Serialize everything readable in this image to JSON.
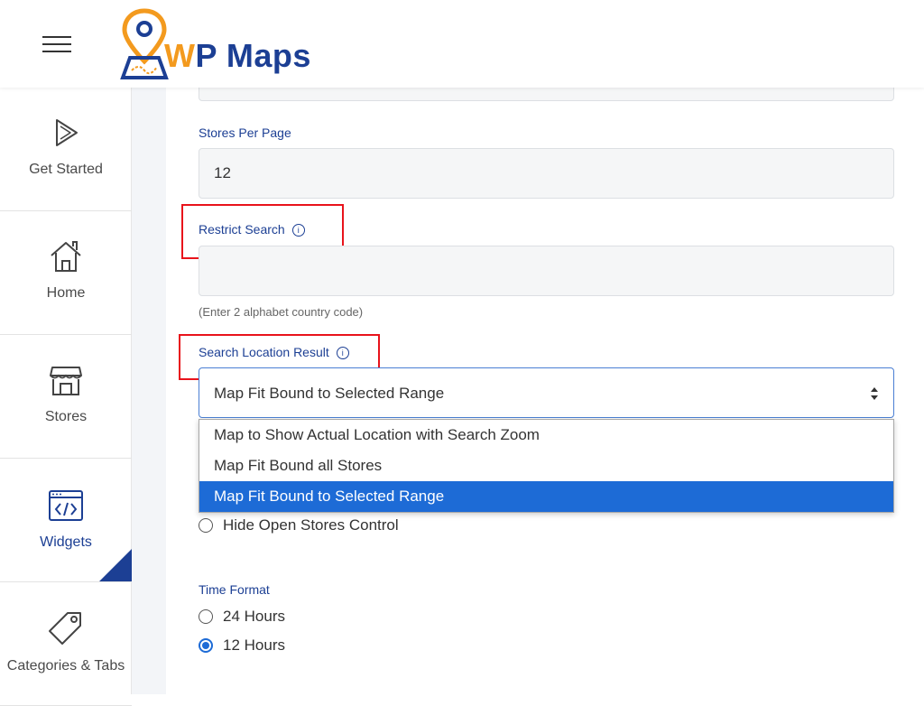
{
  "brand": {
    "logo_text_accent": "W",
    "logo_text_rest": "P Maps",
    "colors": {
      "primary": "#1c3f94",
      "accent": "#f39a1e",
      "highlight": "#e8131b",
      "selected": "#1d6bd6"
    }
  },
  "sidebar": {
    "items": [
      {
        "label": "Get Started",
        "icon": "play-icon"
      },
      {
        "label": "Home",
        "icon": "home-icon"
      },
      {
        "label": "Stores",
        "icon": "store-icon"
      },
      {
        "label": "Widgets",
        "icon": "code-window-icon"
      },
      {
        "label": "Categories & Tabs",
        "icon": "tag-icon"
      }
    ],
    "active": "Widgets"
  },
  "form": {
    "stores_per_page": {
      "label": "Stores Per Page",
      "value": "12"
    },
    "restrict_search": {
      "label": "Restrict Search",
      "value": "",
      "hint": "(Enter 2 alphabet country code)"
    },
    "search_location_result": {
      "label": "Search Location Result",
      "selected": "Map Fit Bound to Selected Range",
      "options": [
        "Map to Show Actual Location with Search Zoom",
        "Map Fit Bound all Stores",
        "Map Fit Bound to Selected Range"
      ]
    },
    "hide_open_stores": {
      "label": "Hide Open Stores Control"
    },
    "time_format": {
      "label": "Time Format",
      "options": [
        "24 Hours",
        "12 Hours"
      ],
      "selected": "12 Hours"
    }
  }
}
